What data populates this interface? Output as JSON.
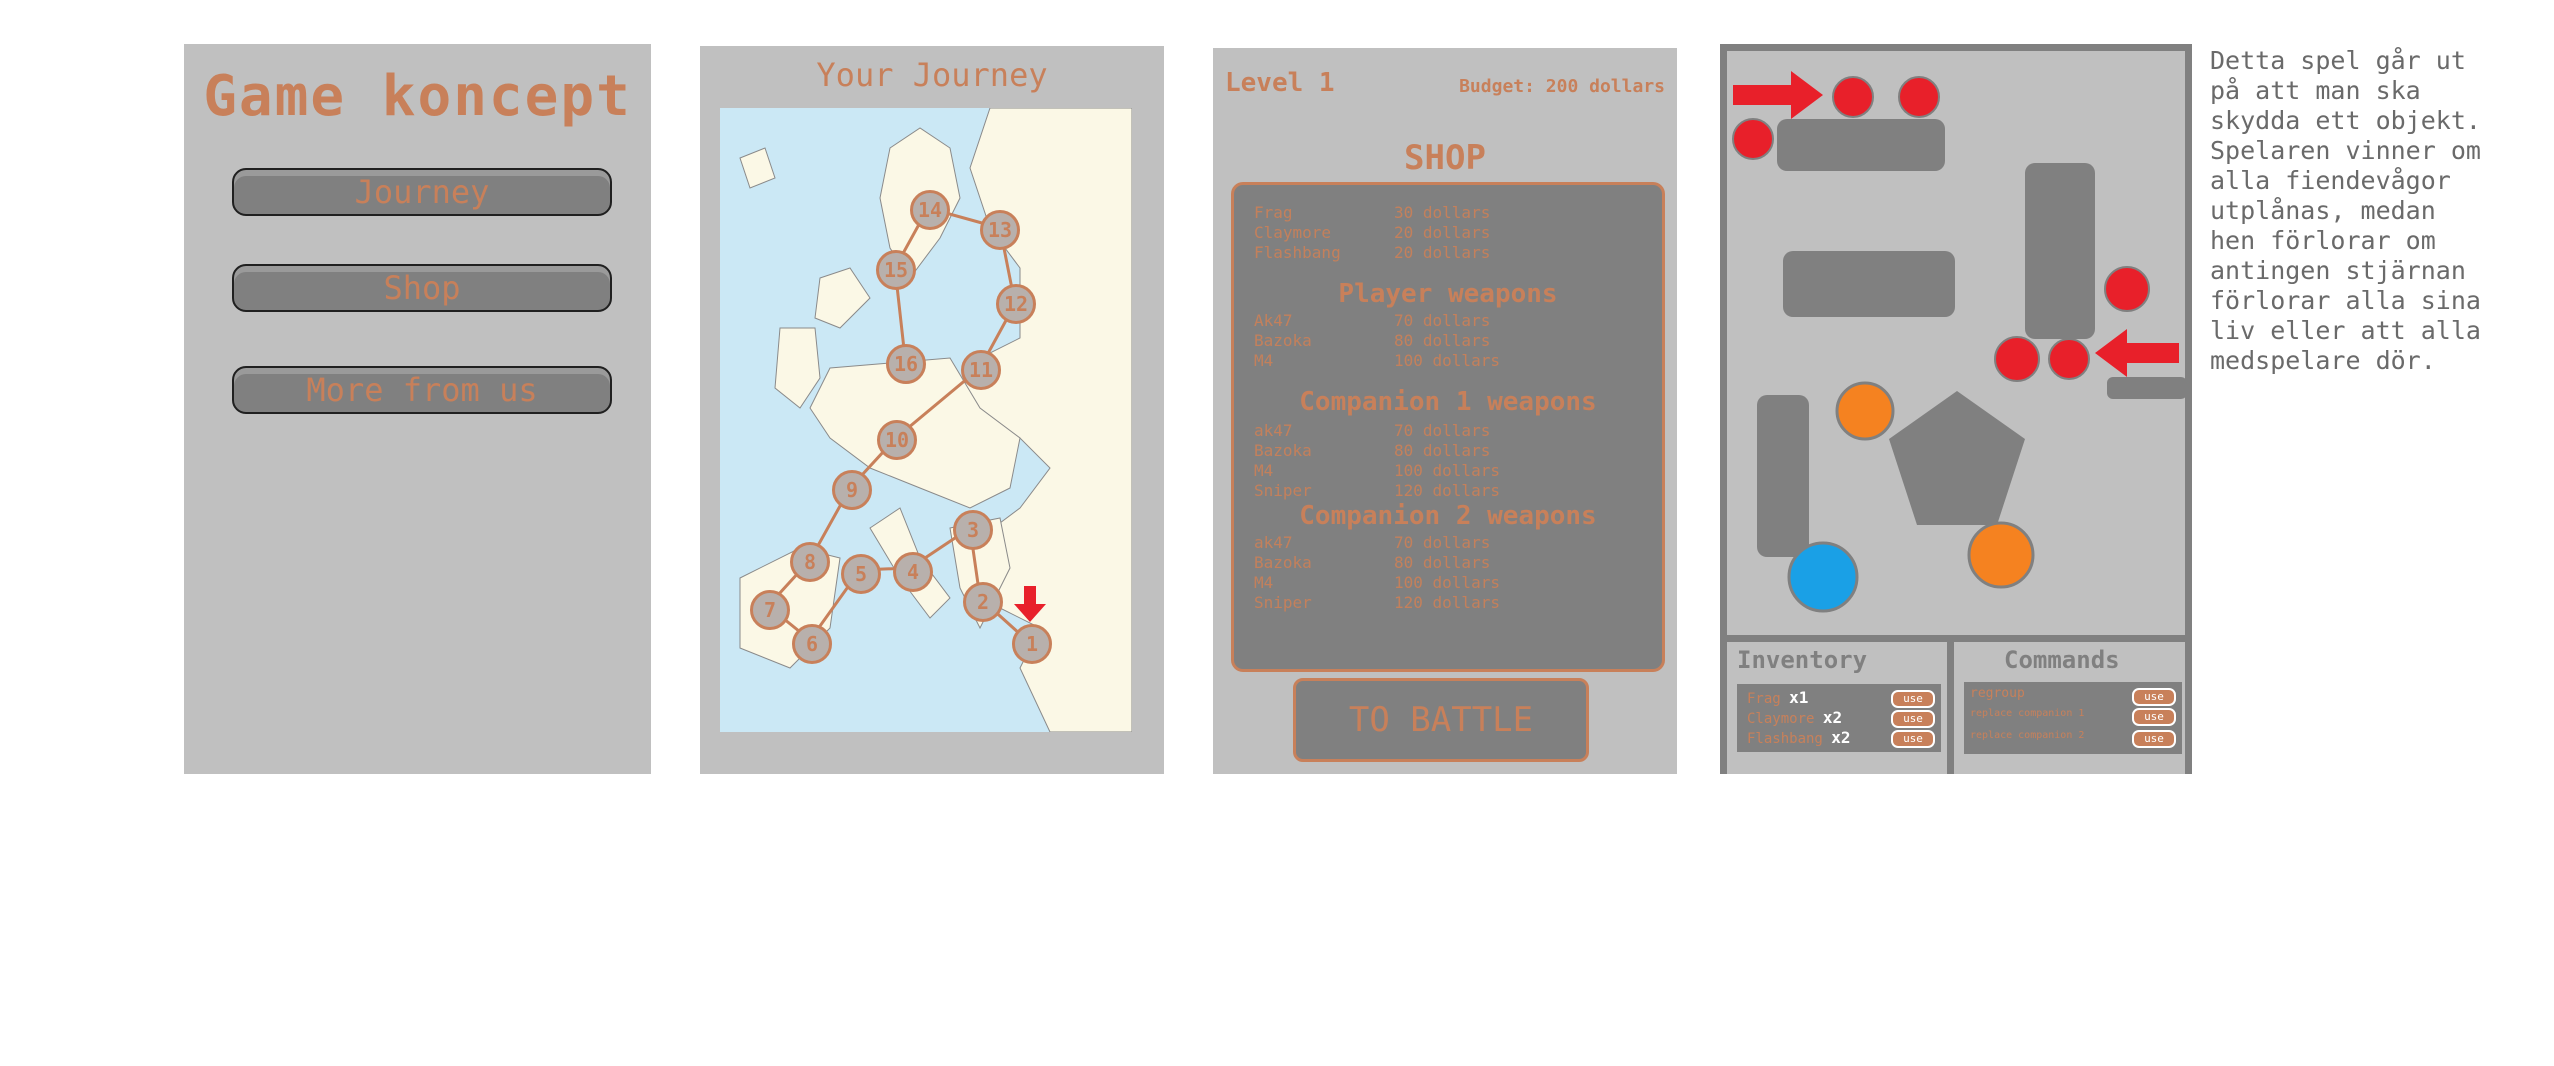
{
  "panel1": {
    "title": "Game koncept",
    "buttons": [
      "Journey",
      "Shop",
      "More from us"
    ]
  },
  "panel2": {
    "title": "Your Journey",
    "nodes": [
      "1",
      "2",
      "3",
      "4",
      "5",
      "6",
      "7",
      "8",
      "9",
      "10",
      "11",
      "12",
      "13",
      "14",
      "15",
      "16"
    ]
  },
  "panel3": {
    "level": "Level 1",
    "budget": "Budget: 200 dollars",
    "shop_title": "SHOP",
    "items": [
      {
        "name": "Frag",
        "price": "30 dollars"
      },
      {
        "name": "Claymore",
        "price": "20 dollars"
      },
      {
        "name": "Flashbang",
        "price": "20 dollars"
      }
    ],
    "player_title": "Player weapons",
    "player_weapons": [
      {
        "name": "Ak47",
        "price": "70 dollars"
      },
      {
        "name": "Bazoka",
        "price": "80 dollars"
      },
      {
        "name": "M4",
        "price": "100 dollars"
      }
    ],
    "comp1_title": "Companion 1 weapons",
    "comp1_weapons": [
      {
        "name": "ak47",
        "price": "70 dollars"
      },
      {
        "name": "Bazoka",
        "price": "80 dollars"
      },
      {
        "name": "M4",
        "price": "100 dollars"
      },
      {
        "name": "Sniper",
        "price": "120 dollars"
      }
    ],
    "comp2_title": "Companion 2 weapons",
    "comp2_weapons": [
      {
        "name": "ak47",
        "price": "70 dollars"
      },
      {
        "name": "Bazoka",
        "price": "80 dollars"
      },
      {
        "name": "M4",
        "price": "100 dollars"
      },
      {
        "name": "Sniper",
        "price": "120 dollars"
      }
    ],
    "battle": "TO BATTLE"
  },
  "panel4": {
    "inventory_title": "Inventory",
    "inventory": [
      {
        "name": "Frag",
        "qty": "x1"
      },
      {
        "name": "Claymore",
        "qty": "x2"
      },
      {
        "name": "Flashbang",
        "qty": "x2"
      }
    ],
    "commands_title": "Commands",
    "commands": [
      "regroup",
      "replace companion 1",
      "replace companion 2"
    ],
    "use_label": "use",
    "colors": {
      "enemy": "#e8202a",
      "companion": "#f58220",
      "player": "#1aa0e6",
      "obstacle": "#808080"
    }
  },
  "description": "Detta spel går ut\npå att man ska\nskydda ett objekt.\nSpelaren vinner om\nalla fiendevågor\nutplånas, medan\nhen förlorar om\nantingen stjärnan\nförlorar alla sina\nliv eller att alla\nmedspelare dör."
}
